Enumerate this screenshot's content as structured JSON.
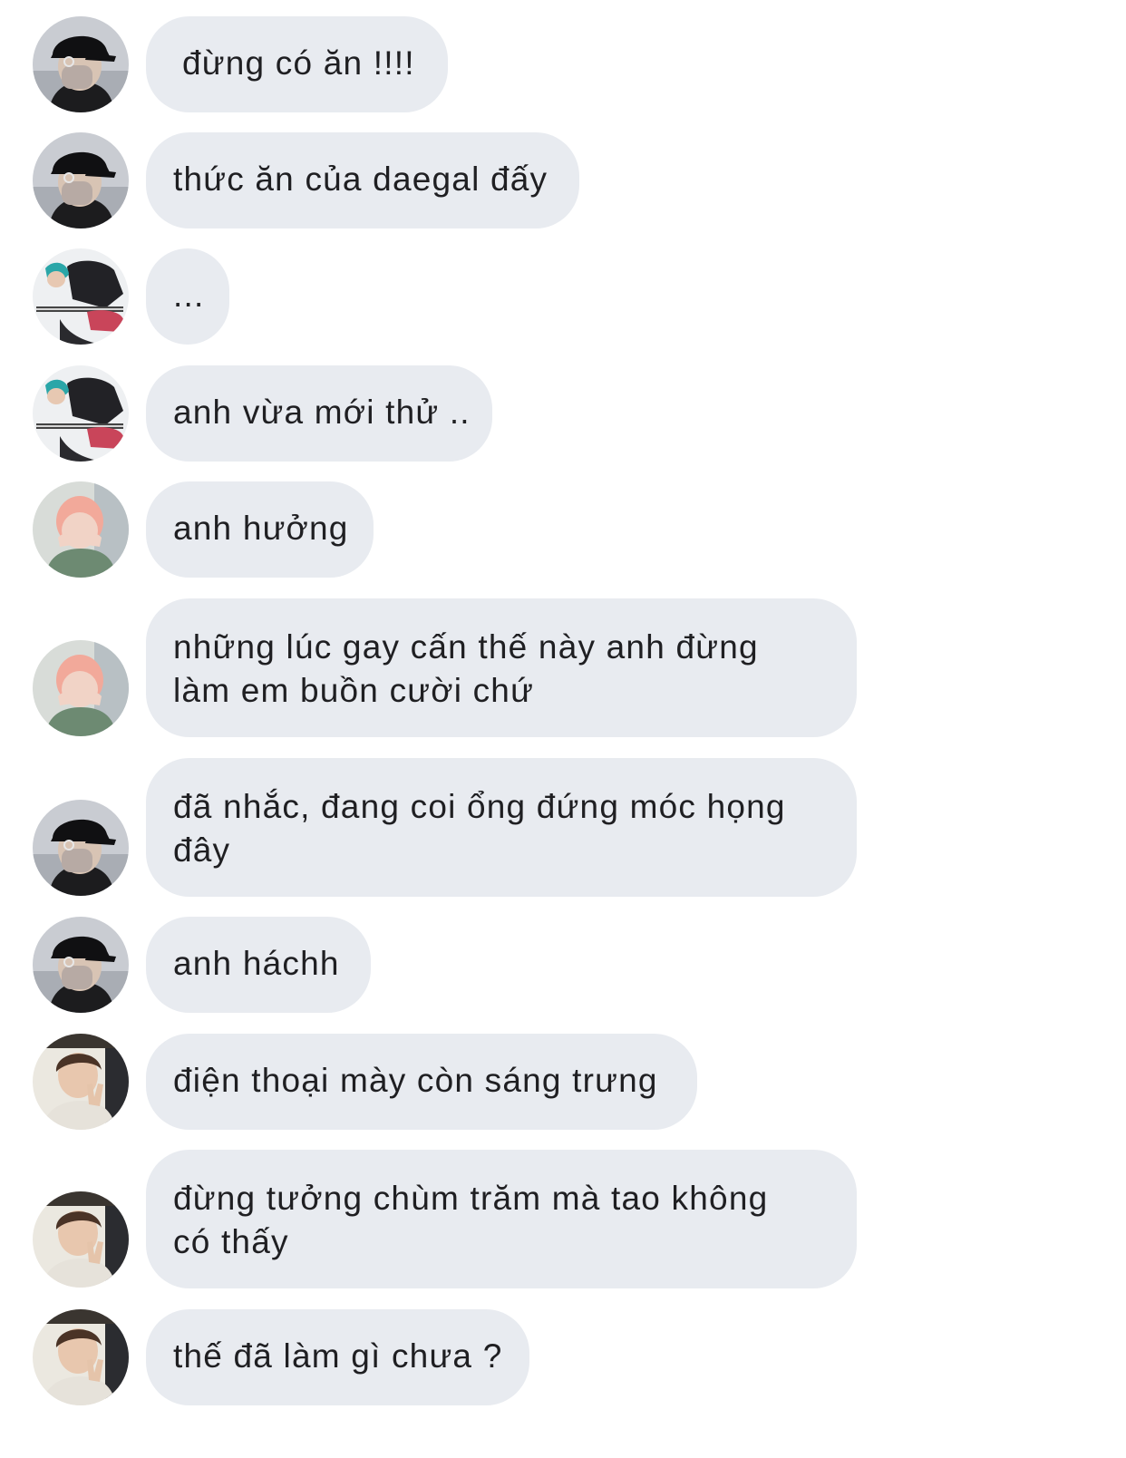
{
  "conversation": {
    "messages": [
      {
        "sender_avatar": "avatar-black-cap",
        "text": "đừng có ăn !!!!",
        "bubble_color": "#e8ebf0"
      },
      {
        "sender_avatar": "avatar-black-cap",
        "text": "thức ăn của daegal đấy",
        "bubble_color": "#e8ebf0"
      },
      {
        "sender_avatar": "avatar-guitar-blue-hair",
        "text": "...",
        "bubble_color": "#e8ebf0"
      },
      {
        "sender_avatar": "avatar-guitar-blue-hair",
        "text": "anh vừa mới thử ..",
        "bubble_color": "#e8ebf0"
      },
      {
        "sender_avatar": "avatar-pink-hair",
        "text": "anh hưởng",
        "bubble_color": "#e8ebf0"
      },
      {
        "sender_avatar": "avatar-pink-hair",
        "text": "những lúc gay cấn thế này anh đừng làm em buồn cười chứ",
        "bubble_color": "#e8ebf0"
      },
      {
        "sender_avatar": "avatar-black-cap",
        "text": "đã nhắc, đang coi ổng đứng móc họng đây",
        "bubble_color": "#e8ebf0"
      },
      {
        "sender_avatar": "avatar-black-cap",
        "text": "anh háchh",
        "bubble_color": "#e8ebf0"
      },
      {
        "sender_avatar": "avatar-peace-sign",
        "text": "điện thoại mày còn sáng trưng",
        "bubble_color": "#e8ebf0"
      },
      {
        "sender_avatar": "avatar-peace-sign",
        "text": "đừng tưởng chùm trăm mà tao không có thấy",
        "bubble_color": "#e8ebf0"
      },
      {
        "sender_avatar": "avatar-peace-sign",
        "text": "thế đã làm gì chưa ?",
        "bubble_color": "#e8ebf0"
      }
    ]
  }
}
